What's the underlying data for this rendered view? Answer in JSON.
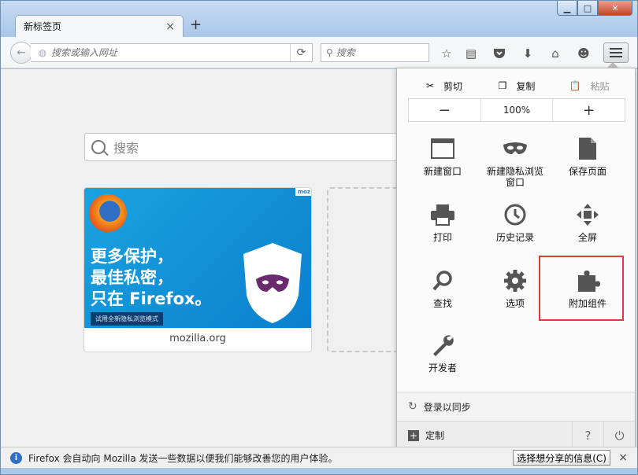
{
  "window": {
    "minimize_icon": "minimize-icon",
    "maximize_icon": "maximize-icon",
    "close_icon": "close-icon"
  },
  "tabs": [
    {
      "title": "新标签页",
      "close": "×"
    }
  ],
  "new_tab": "+",
  "navbar": {
    "url_placeholder": "搜索或输入网址",
    "search_placeholder": "搜索",
    "icons": [
      "star-icon",
      "reading-list-icon",
      "pocket-icon",
      "download-icon",
      "home-icon",
      "hello-icon"
    ]
  },
  "page": {
    "search_label": "搜索",
    "tiles": [
      {
        "caption": "mozilla.org",
        "headline_lines": [
          "更多保护，",
          "最佳私密，",
          "只在 Firefox。"
        ],
        "cta": "试用全新隐私浏览模式",
        "brand": "moz"
      }
    ]
  },
  "menu": {
    "edit": {
      "cut": "剪切",
      "copy": "复制",
      "paste": "粘贴"
    },
    "zoom": {
      "minus": "−",
      "level": "100%",
      "plus": "+"
    },
    "items": [
      {
        "label": "新建窗口",
        "icon": "new-window-icon"
      },
      {
        "label": "新建隐私浏览窗口",
        "icon": "private-mask-icon"
      },
      {
        "label": "保存页面",
        "icon": "save-page-icon"
      },
      {
        "label": "打印",
        "icon": "print-icon"
      },
      {
        "label": "历史记录",
        "icon": "history-icon"
      },
      {
        "label": "全屏",
        "icon": "fullscreen-icon"
      },
      {
        "label": "查找",
        "icon": "find-icon"
      },
      {
        "label": "选项",
        "icon": "options-gear-icon"
      },
      {
        "label": "附加组件",
        "icon": "addons-puzzle-icon"
      },
      {
        "label": "开发者",
        "icon": "developer-wrench-icon"
      }
    ],
    "sync": "登录以同步",
    "customize": "定制",
    "help_icon": "help-icon",
    "quit_icon": "quit-icon"
  },
  "notification": {
    "text": "Firefox 会自动向 Mozilla 发送一些数据以便我们能够改善您的用户体验。",
    "button": "选择想分享的信息(C)",
    "close": "×"
  },
  "colors": {
    "frame": "#aac8ea",
    "highlight": "#e53935",
    "tile_blue": "#1aa3e0"
  }
}
